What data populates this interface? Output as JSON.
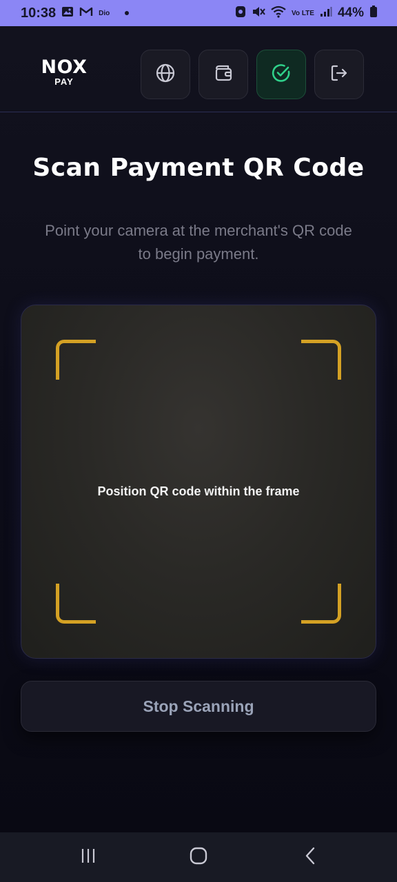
{
  "status_bar": {
    "time": "10:38",
    "carrier": "Dio",
    "network": "Vo LTE",
    "battery_percent": "44%"
  },
  "header": {
    "logo_top": "NOX",
    "logo_bottom": "PAY",
    "buttons": [
      {
        "icon": "globe-icon"
      },
      {
        "icon": "wallet-icon"
      },
      {
        "icon": "check-circle-icon",
        "active": true
      },
      {
        "icon": "logout-icon"
      }
    ]
  },
  "page": {
    "title": "Scan Payment QR Code",
    "subtitle": "Point your camera at the merchant's QR code to begin payment."
  },
  "scanner": {
    "hint": "Position QR code within the frame",
    "corner_color": "#d4a124"
  },
  "actions": {
    "stop_label": "Stop Scanning"
  },
  "colors": {
    "status_bar": "#8b86f5",
    "active_button": "#2fd18a",
    "accent": "#d4a124"
  }
}
